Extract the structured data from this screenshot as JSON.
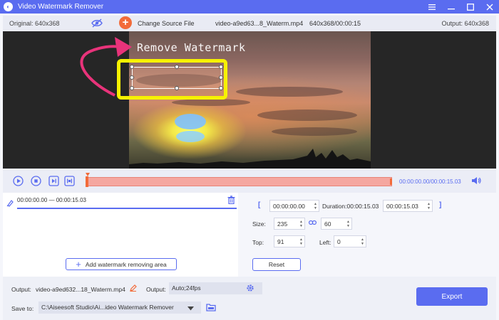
{
  "window": {
    "title": "Video Watermark Remover"
  },
  "infobar": {
    "original": "Original: 640x368",
    "change_source": "Change Source File",
    "file_name": "video-a9ed63...8_Waterm.mp4",
    "file_info": "640x368/00:00:15",
    "output": "Output: 640x368"
  },
  "preview": {
    "watermark_text": "Remove Watermark"
  },
  "controls": {
    "time_readout": "00:00:00.00/00:00:15.03"
  },
  "clip": {
    "range": "00:00:00.00 — 00:00:15.03"
  },
  "add_area_label": "Add watermark removing area",
  "settings": {
    "bracket_open": "[",
    "bracket_close": "]",
    "start_time": "00:00:00.00",
    "duration": "Duration:00:00:15.03",
    "end_time": "00:00:15.03",
    "size_label": "Size:",
    "width": "235",
    "height": "60",
    "top_label": "Top:",
    "top": "91",
    "left_label": "Left:",
    "left": "0",
    "reset_label": "Reset"
  },
  "bottom": {
    "output_label": "Output:",
    "output_file": "video-a9ed632...18_Waterm.mp4",
    "format_label": "Output:",
    "format_value": "Auto;24fps",
    "save_label": "Save to:",
    "save_path": "C:\\Aiseesoft Studio\\Ai...ideo Watermark Remover",
    "export_label": "Export"
  },
  "colors": {
    "accent": "#5a6cf0",
    "orange": "#f26b3a",
    "highlight": "#f7f200",
    "arrow": "#e8337a"
  }
}
